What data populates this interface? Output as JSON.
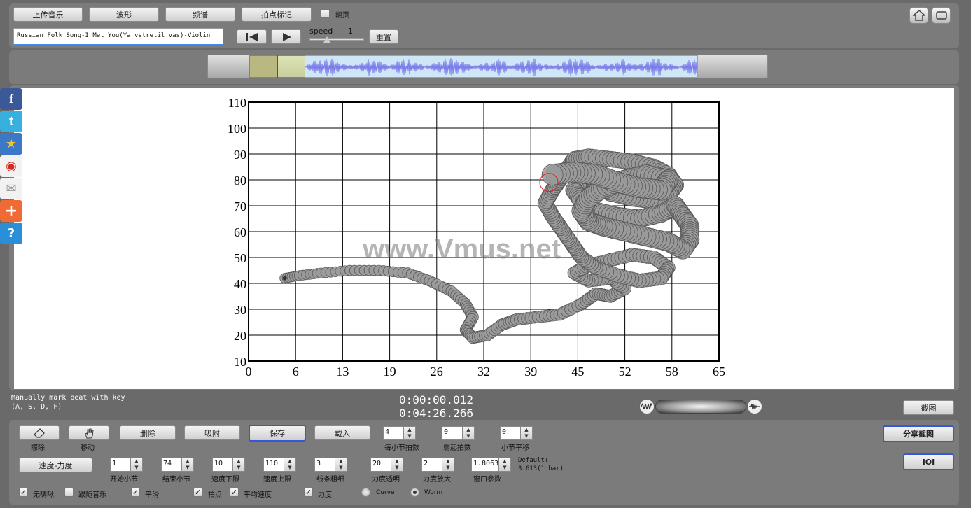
{
  "toolbar": {
    "upload": "上传音乐",
    "waveform": "波形",
    "spectrum": "频谱",
    "beat_mark": "拍点标记",
    "page_turn": "翻页"
  },
  "player": {
    "filename": "Russian_Folk_Song-I_Met_You(Ya_vstretil_vas)-Violin",
    "speed_label": "speed",
    "speed_value": "1",
    "reset": "重置",
    "speed": 1
  },
  "status": {
    "hint_line1": "Manually mark beat with key",
    "hint_line2": "(A, S, D, F)",
    "current_time": "0:00:00.012",
    "total_time": "0:04:26.266",
    "screenshot": "截图"
  },
  "watermark": "www.Vmus.net",
  "controls": {
    "erase": "擦除",
    "move": "移动",
    "delete": "删除",
    "snap": "吸附",
    "save": "保存",
    "load": "载入",
    "share": "分享截图",
    "ioi": "IOI",
    "tempo_dynamics": "速度-力度",
    "beats_per_bar": {
      "label": "每小节拍数",
      "value": "4"
    },
    "pickup": {
      "label": "弱起拍数",
      "value": "0"
    },
    "bar_offset": {
      "label": "小节平移",
      "value": "0"
    },
    "start_bar": {
      "label": "开始小节",
      "value": "1"
    },
    "end_bar": {
      "label": "结束小节",
      "value": "74"
    },
    "tempo_min": {
      "label": "速度下限",
      "value": "10"
    },
    "tempo_max": {
      "label": "速度上限",
      "value": "110"
    },
    "line_width": {
      "label": "线条粗细",
      "value": "3"
    },
    "dyn_opacity": {
      "label": "力度透明",
      "value": "20"
    },
    "dyn_scale": {
      "label": "力度放大",
      "value": "2"
    },
    "window_param": {
      "label": "窗口参数",
      "value": "1.8063"
    },
    "default_line1": "Default:",
    "default_line2": "3.613(1 bar)"
  },
  "options": {
    "no_chirp": "无啁啾",
    "follow_music": "跟随音乐",
    "smooth": "平滑",
    "beat": "拍点",
    "avg_tempo": "平均速度",
    "dynamics": "力度",
    "curve": "Curve",
    "worm": "Worm"
  },
  "colors": {
    "worm_fill": "#9a9a9a",
    "waveform": "#7a7ae8",
    "accent": "#3558d8"
  },
  "chart_data": {
    "type": "scatter",
    "x_ticks": [
      "0",
      "6",
      "13",
      "19",
      "26",
      "32",
      "39",
      "45",
      "52",
      "58",
      "65"
    ],
    "y_ticks": [
      "110",
      "100",
      "90",
      "80",
      "70",
      "60",
      "50",
      "40",
      "30",
      "20",
      "10"
    ],
    "xlim": [
      0,
      65
    ],
    "ylim": [
      10,
      110
    ],
    "grid": true,
    "points": [
      [
        5,
        42
      ],
      [
        7,
        43
      ],
      [
        10,
        44
      ],
      [
        14,
        45
      ],
      [
        18,
        45
      ],
      [
        22,
        44
      ],
      [
        25,
        41
      ],
      [
        28,
        37
      ],
      [
        30,
        32
      ],
      [
        31,
        27
      ],
      [
        30,
        22
      ],
      [
        31,
        19
      ],
      [
        33,
        20
      ],
      [
        35,
        24
      ],
      [
        37,
        26
      ],
      [
        40,
        27
      ],
      [
        43,
        28
      ],
      [
        46,
        32
      ],
      [
        48,
        36
      ],
      [
        50,
        35
      ],
      [
        52,
        38
      ],
      [
        50,
        42
      ],
      [
        47,
        41
      ],
      [
        45,
        44
      ],
      [
        47,
        47
      ],
      [
        50,
        49
      ],
      [
        53,
        51
      ],
      [
        56,
        50
      ],
      [
        58,
        46
      ],
      [
        57,
        42
      ],
      [
        54,
        41
      ],
      [
        51,
        43
      ],
      [
        48,
        46
      ],
      [
        46,
        50
      ],
      [
        45,
        54
      ],
      [
        44,
        58
      ],
      [
        43,
        62
      ],
      [
        42,
        66
      ],
      [
        41,
        71
      ],
      [
        42,
        76
      ],
      [
        43,
        80
      ],
      [
        44,
        84
      ],
      [
        45,
        88
      ],
      [
        47,
        89
      ],
      [
        50,
        88
      ],
      [
        53,
        87
      ],
      [
        56,
        85
      ],
      [
        58,
        82
      ],
      [
        59,
        78
      ],
      [
        58,
        74
      ],
      [
        56,
        72
      ],
      [
        53,
        73
      ],
      [
        50,
        75
      ],
      [
        48,
        78
      ],
      [
        46,
        80
      ],
      [
        45,
        76
      ],
      [
        46,
        72
      ],
      [
        48,
        68
      ],
      [
        51,
        66
      ],
      [
        54,
        65
      ],
      [
        57,
        67
      ],
      [
        59,
        70
      ],
      [
        60,
        66
      ],
      [
        61,
        62
      ],
      [
        61,
        57
      ],
      [
        60,
        53
      ],
      [
        58,
        56
      ],
      [
        55,
        58
      ],
      [
        52,
        60
      ],
      [
        49,
        62
      ],
      [
        47,
        64
      ],
      [
        46,
        68
      ],
      [
        47,
        73
      ],
      [
        49,
        77
      ],
      [
        52,
        80
      ],
      [
        55,
        82
      ],
      [
        58,
        80
      ],
      [
        57,
        76
      ],
      [
        54,
        77
      ],
      [
        51,
        79
      ],
      [
        48,
        82
      ],
      [
        45,
        83
      ],
      [
        42,
        82
      ]
    ]
  }
}
